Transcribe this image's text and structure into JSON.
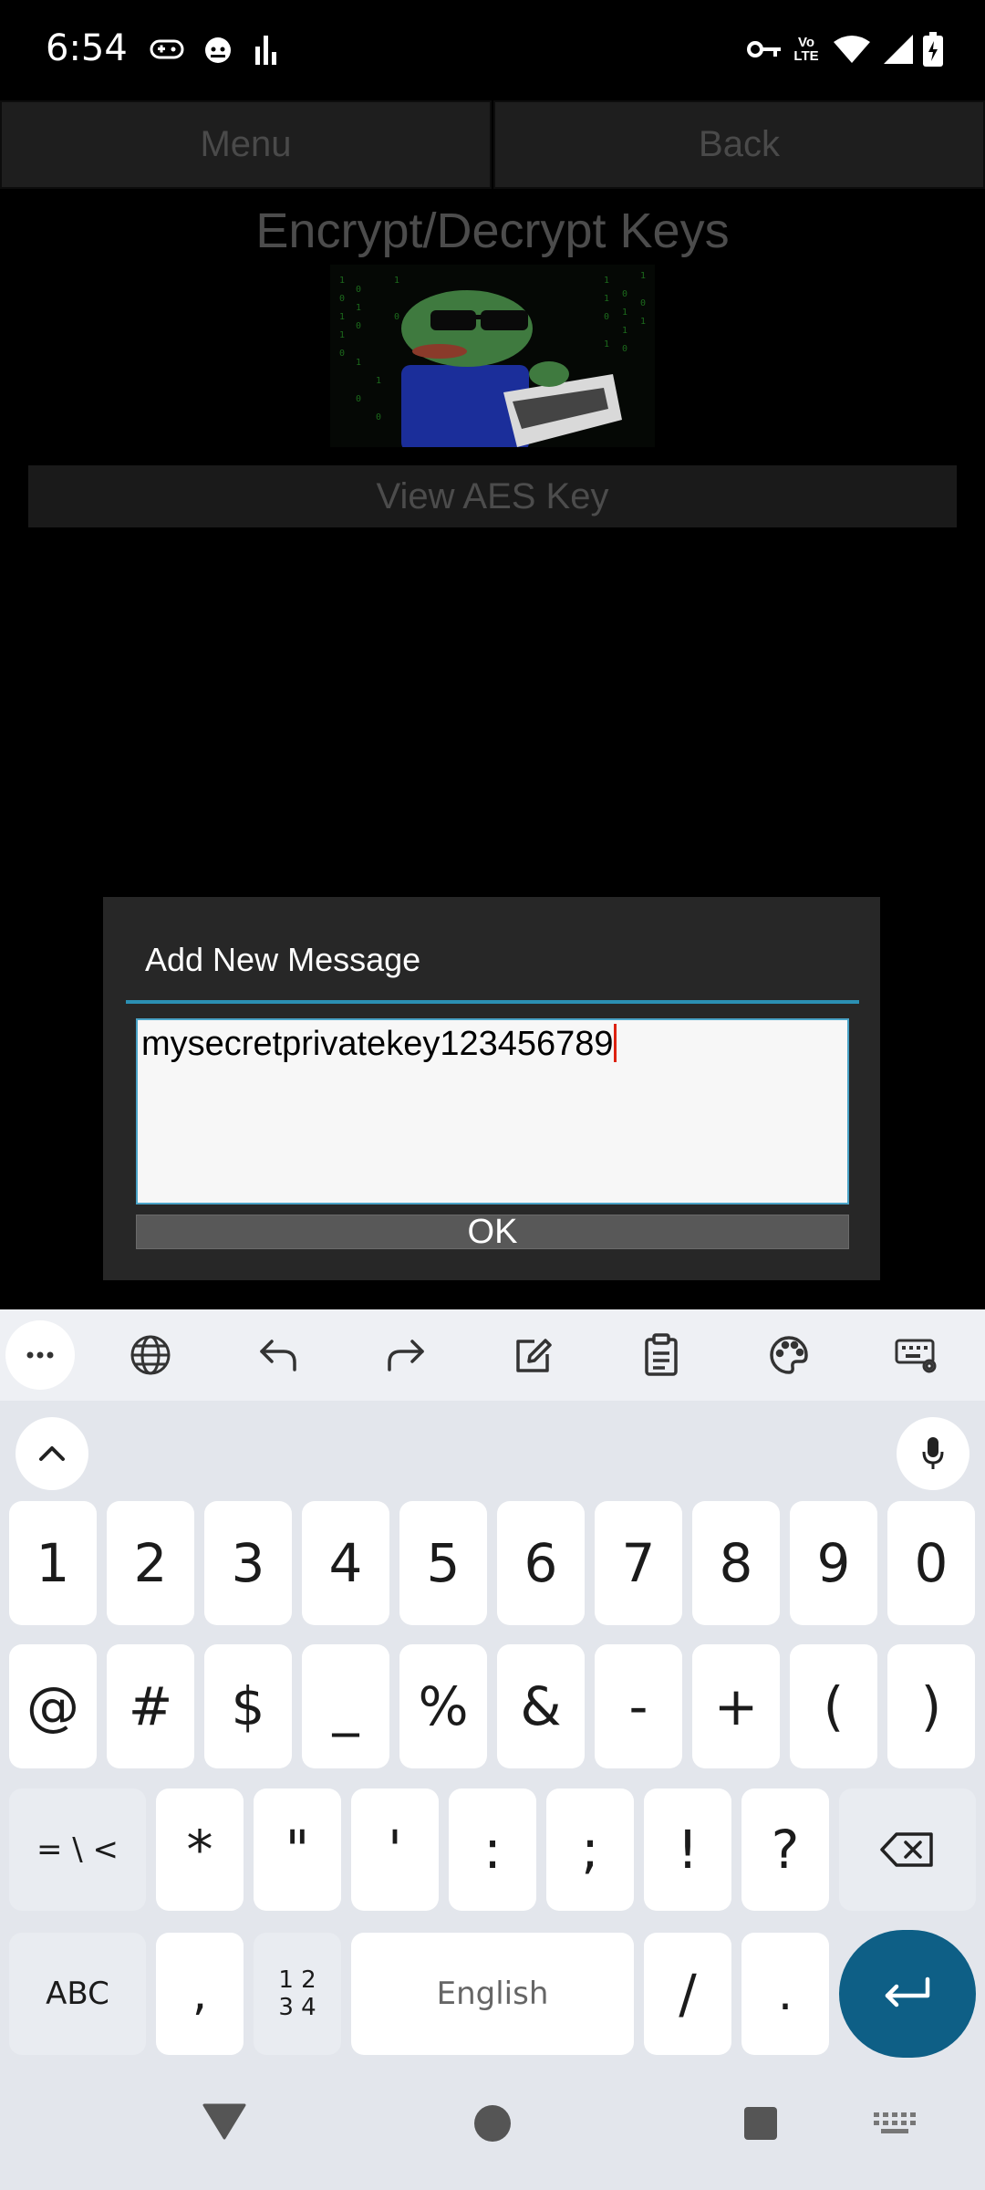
{
  "status_bar": {
    "time": "6:54",
    "icons_left": [
      "game-controller-icon",
      "cat-face-icon",
      "signal-bars-icon"
    ],
    "icons_right": [
      "vpn-key-icon",
      "volte-icon",
      "wifi-icon",
      "cell-signal-icon",
      "battery-icon"
    ],
    "volte_label": "Vo LTE"
  },
  "app": {
    "menu_label": "Menu",
    "back_label": "Back",
    "title": "Encrypt/Decrypt Keys",
    "hero_image": "pepe-hacker-matrix-image",
    "view_aes_label": "View AES Key"
  },
  "dialog": {
    "title": "Add New Message",
    "input_value": "mysecretprivatekey123456789",
    "ok_label": "OK"
  },
  "keyboard": {
    "toolbar": [
      "more-icon",
      "globe-icon",
      "undo-icon",
      "redo-icon",
      "edit-icon",
      "clipboard-icon",
      "palette-icon",
      "keyboard-settings-icon"
    ],
    "row_numbers": [
      "1",
      "2",
      "3",
      "4",
      "5",
      "6",
      "7",
      "8",
      "9",
      "0"
    ],
    "row_symbols": [
      "@",
      "#",
      "$",
      "_",
      "%",
      "&",
      "-",
      "+",
      "(",
      ")"
    ],
    "row_more": {
      "more_symbols": "= \\ <",
      "keys": [
        "*",
        "\"",
        "'",
        ":",
        ";",
        "!",
        "?"
      ]
    },
    "row_bottom": {
      "abc": "ABC",
      "comma": ",",
      "numpad_top": "1 2",
      "numpad_bottom": "3 4",
      "space": "English",
      "slash": "/",
      "period": "."
    },
    "accent_color": "#0e5f86"
  },
  "nav_bar": [
    "back-triangle-icon",
    "home-circle-icon",
    "recents-square-icon",
    "keyboard-switch-icon"
  ]
}
